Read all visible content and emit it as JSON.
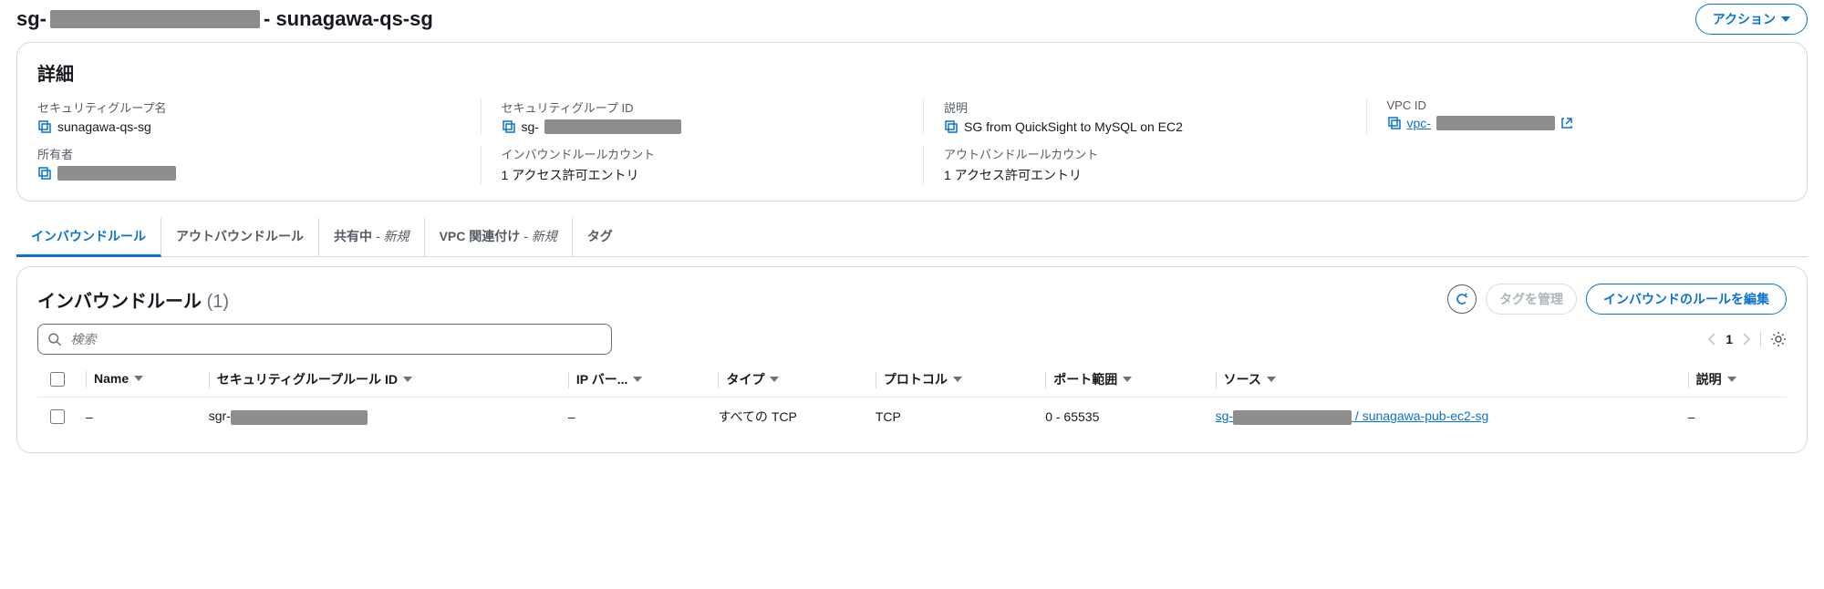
{
  "header": {
    "title_prefix": "sg-",
    "title_suffix": "- sunagawa-qs-sg",
    "actions_label": "アクション"
  },
  "details": {
    "panel_title": "詳細",
    "sg_name_label": "セキュリティグループ名",
    "sg_name_value": "sunagawa-qs-sg",
    "sg_id_label": "セキュリティグループ ID",
    "sg_id_value": "sg-",
    "description_label": "説明",
    "description_value": "SG from QuickSight to MySQL on EC2",
    "vpc_id_label": "VPC ID",
    "vpc_id_value": "vpc-",
    "owner_label": "所有者",
    "inbound_count_label": "インバウンドルールカウント",
    "inbound_count_value": "1 アクセス許可エントリ",
    "outbound_count_label": "アウトバンドルールカウント",
    "outbound_count_value": "1 アクセス許可エントリ"
  },
  "tabs": {
    "inbound": "インバウンドルール",
    "outbound": "アウトバウンドルール",
    "sharing": "共有中",
    "sharing_flag": "- 新規",
    "vpc_assoc": "VPC 関連付け",
    "vpc_assoc_flag": "- 新規",
    "tags": "タグ"
  },
  "rules_section": {
    "title": "インバウンドルール",
    "count": "(1)",
    "manage_tags": "タグを管理",
    "edit_rules": "インバウンドのルールを編集"
  },
  "search": {
    "placeholder": "検索"
  },
  "pagination": {
    "page": "1"
  },
  "columns": {
    "name": "Name",
    "rule_id": "セキュリティグループルール ID",
    "ip_ver": "IP バー...",
    "type": "タイプ",
    "protocol": "プロトコル",
    "port_range": "ポート範囲",
    "source": "ソース",
    "description": "説明"
  },
  "rows": [
    {
      "name": "–",
      "rule_id_prefix": "sgr-",
      "ip_ver": "–",
      "type": "すべての TCP",
      "protocol": "TCP",
      "port_range": "0 - 65535",
      "source_prefix": "sg-",
      "source_suffix": " / sunagawa-pub-ec2-sg",
      "description": "–"
    }
  ]
}
